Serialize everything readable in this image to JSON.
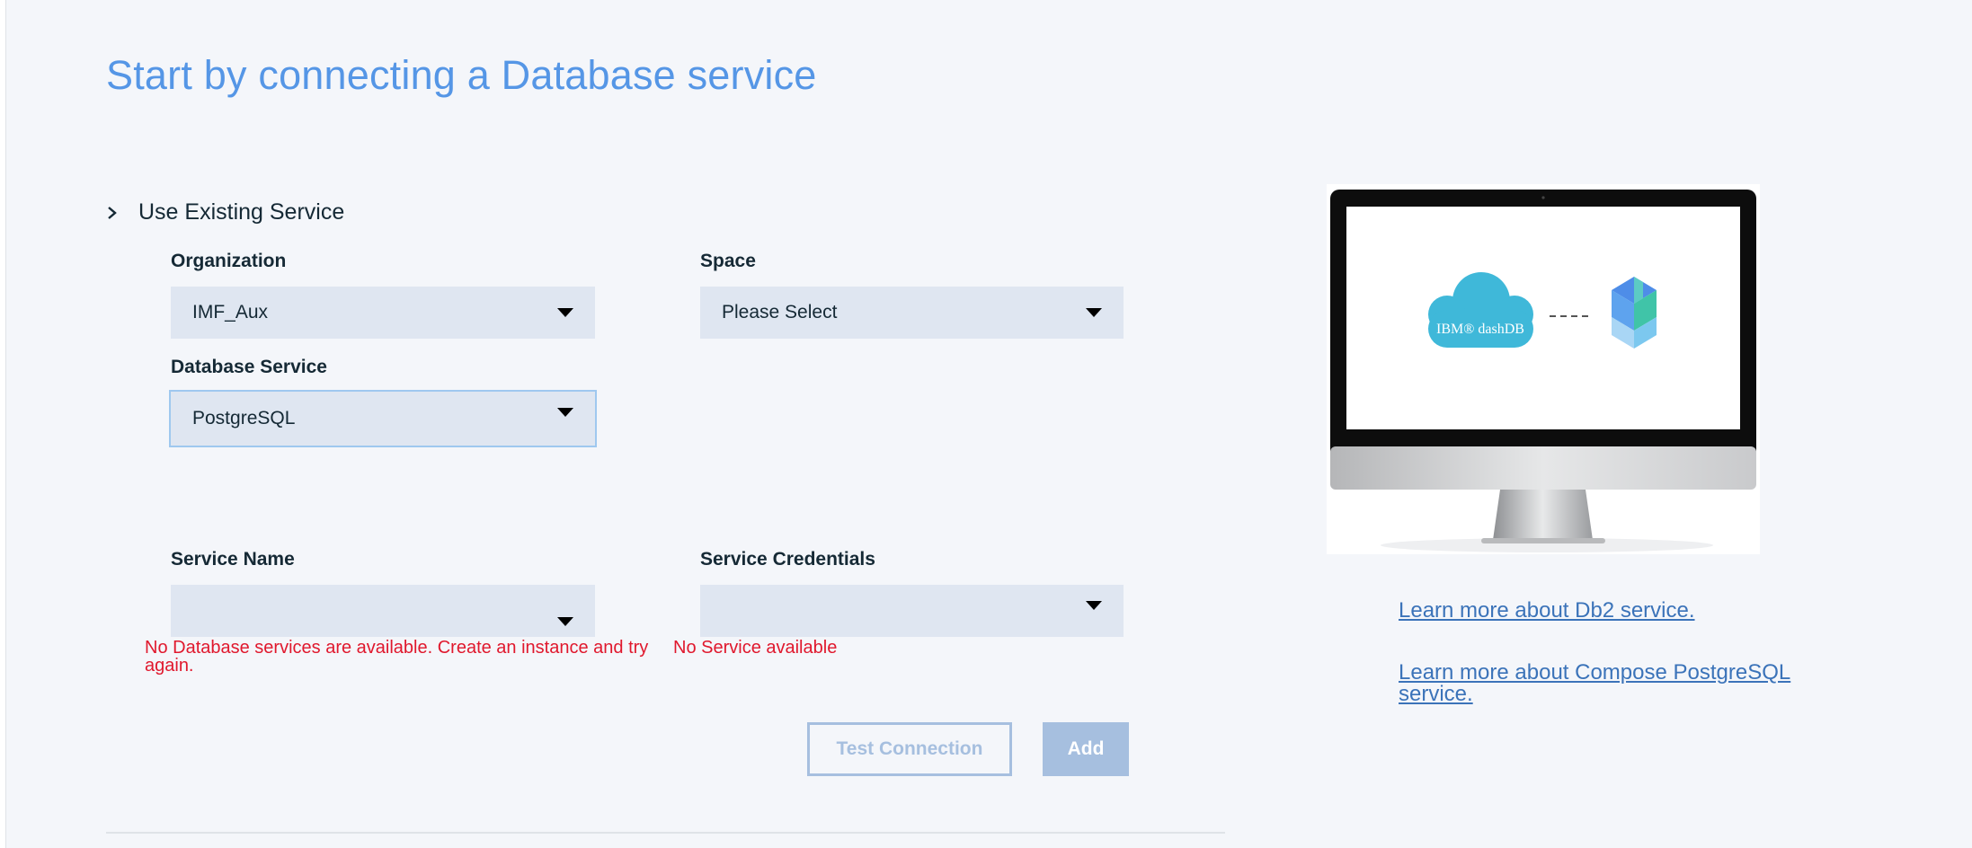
{
  "page": {
    "title": "Start by connecting a Database service"
  },
  "expander": {
    "label": "Use Existing Service"
  },
  "organization": {
    "label": "Organization",
    "value": "IMF_Aux"
  },
  "space": {
    "label": "Space",
    "value": "Please Select"
  },
  "database_service": {
    "label": "Database Service",
    "value": "PostgreSQL"
  },
  "service_name": {
    "label": "Service Name",
    "value": "",
    "error_line1": "No Database services are available. Create an instance and try",
    "error_line2": "again."
  },
  "service_credentials": {
    "label": "Service Credentials",
    "value": "",
    "error": "No Service available"
  },
  "buttons": {
    "test_connection": "Test Connection",
    "add": "Add"
  },
  "illustration": {
    "brand_text": "IBM® dashDB",
    "icon": "monitor-illustration"
  },
  "links": {
    "db2": "Learn more about Db2 service.",
    "postgres_line1": "Learn more about Compose PostgreSQL",
    "postgres_line2": "service."
  },
  "colors": {
    "accent": "#5596e6",
    "error": "#e0182d",
    "link": "#3b73b9",
    "disabled_button": "#a6bfdf"
  }
}
